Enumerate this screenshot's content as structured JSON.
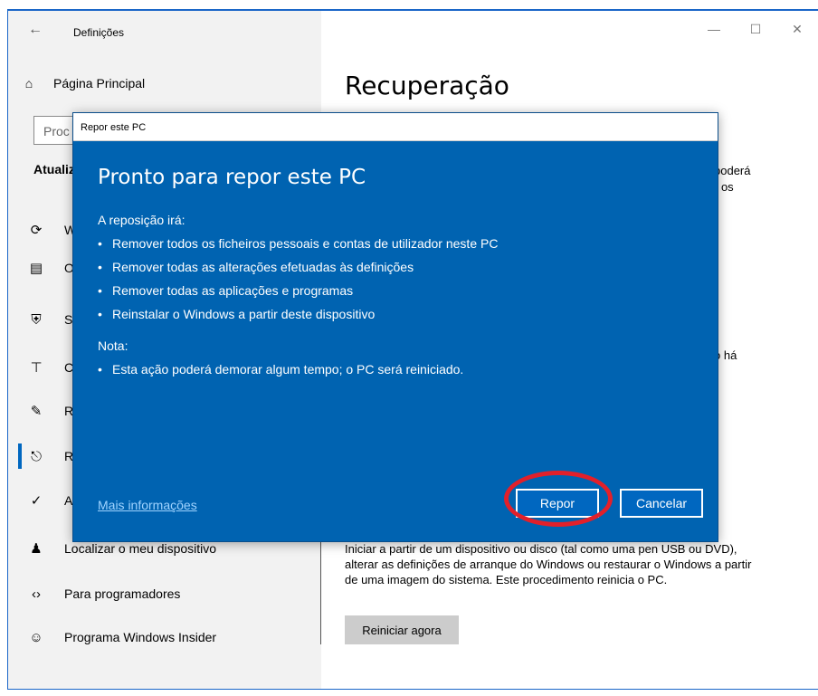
{
  "window": {
    "title": "Definições",
    "back_icon": "back-arrow-icon",
    "controls": [
      "minimize-icon",
      "maximize-icon",
      "close-icon"
    ]
  },
  "sidebar": {
    "home_label": "Página Principal",
    "search_placeholder": "Proc",
    "section_title": "Atualiz",
    "items": [
      {
        "icon": "sync-icon",
        "label": "W"
      },
      {
        "icon": "delivery-optimization-icon",
        "label": "O"
      },
      {
        "icon": "shield-icon",
        "label": "S"
      },
      {
        "icon": "backup-icon",
        "label": "C"
      },
      {
        "icon": "wrench-icon",
        "label": "R"
      },
      {
        "icon": "recovery-icon",
        "label": "R"
      },
      {
        "icon": "activation-icon",
        "label": "A"
      },
      {
        "icon": "find-device-icon",
        "label": "Localizar o meu dispositivo"
      },
      {
        "icon": "developer-icon",
        "label": "Para programadores"
      },
      {
        "icon": "insider-icon",
        "label": "Programa Windows Insider"
      }
    ]
  },
  "main": {
    "page_title": "Recuperação",
    "fragments": [
      "poderá",
      "r os",
      "o há"
    ],
    "advanced_startup_text": "Iniciar a partir de um dispositivo ou disco (tal como uma pen USB ou DVD), alterar as definições de arranque do Windows ou restaurar o Windows a partir de uma imagem do sistema. Este procedimento reinicia o PC.",
    "restart_button": "Reiniciar agora"
  },
  "dialog": {
    "title": "Repor este PC",
    "heading": "Pronto para repor este PC",
    "intro": "A reposição irá:",
    "bullets": [
      "Remover todos os ficheiros pessoais e contas de utilizador neste PC",
      "Remover todas as alterações efetuadas às definições",
      "Remover todas as aplicações e programas",
      "Reinstalar o Windows a partir deste dispositivo"
    ],
    "note_label": "Nota:",
    "note_bullet": "Esta ação poderá demorar algum tempo; o PC será reiniciado.",
    "more_info": "Mais informações",
    "primary_button": "Repor",
    "cancel_button": "Cancelar"
  },
  "colors": {
    "dialog_bg": "#0063b1",
    "accent": "#0067c0",
    "highlight": "#e2202a"
  }
}
